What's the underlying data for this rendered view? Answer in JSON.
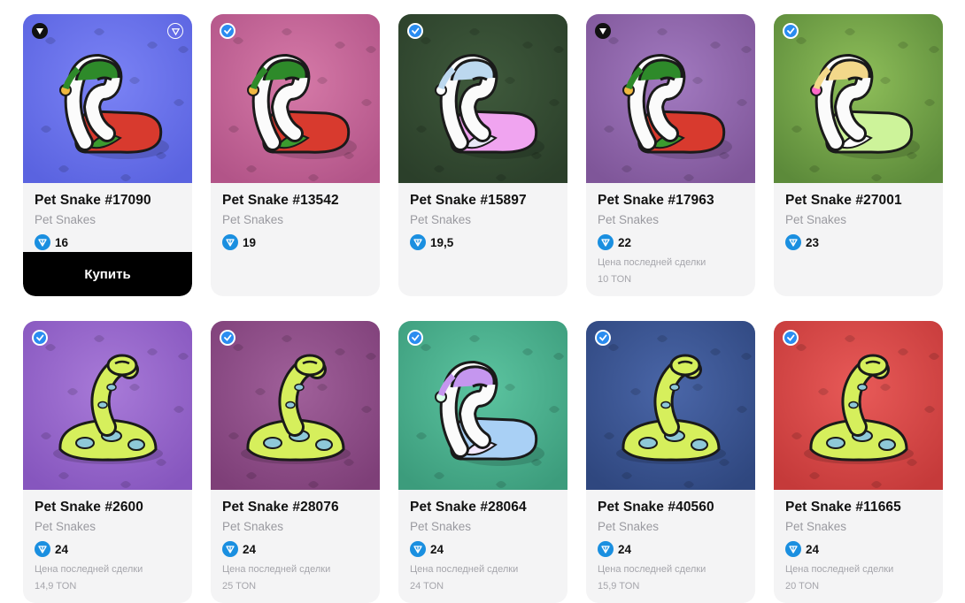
{
  "buy_label": "Купить",
  "ton_icon": "ton-diamond-icon",
  "cards": [
    {
      "title": "Pet Snake #17090",
      "collection": "Pet Snakes",
      "price": "16",
      "last_label": "",
      "last_value": "",
      "badge": "dark",
      "bg1": "#7b83f5",
      "bg2": "#5a63e0",
      "snake": "flamingo-red"
    },
    {
      "title": "Pet Snake #13542",
      "collection": "Pet Snakes",
      "price": "19",
      "last_label": "",
      "last_value": "",
      "badge": "blue",
      "bg1": "#d67aa8",
      "bg2": "#b25488",
      "snake": "flamingo-red"
    },
    {
      "title": "Pet Snake #15897",
      "collection": "Pet Snakes",
      "price": "19,5",
      "last_label": "",
      "last_value": "",
      "badge": "blue",
      "bg1": "#3f5a3c",
      "bg2": "#2b3f2a",
      "snake": "pastel-pink"
    },
    {
      "title": "Pet Snake #17963",
      "collection": "Pet Snakes",
      "price": "22",
      "last_label": "Цена последней сделки",
      "last_value": "10 TON",
      "badge": "dark",
      "bg1": "#a27ac0",
      "bg2": "#7f5699",
      "snake": "flamingo-red"
    },
    {
      "title": "Pet Snake #27001",
      "collection": "Pet Snakes",
      "price": "23",
      "last_label": "",
      "last_value": "",
      "badge": "blue",
      "bg1": "#8fbf5a",
      "bg2": "#5c8a3a",
      "snake": "pastel-green"
    },
    {
      "title": "Pet Snake #2600",
      "collection": "Pet Snakes",
      "price": "24",
      "last_label": "Цена последней сделки",
      "last_value": "14,9 TON",
      "badge": "blue",
      "bg1": "#a87ad8",
      "bg2": "#8656be",
      "snake": "coil-lime"
    },
    {
      "title": "Pet Snake #28076",
      "collection": "Pet Snakes",
      "price": "24",
      "last_label": "Цена последней сделки",
      "last_value": "25 TON",
      "badge": "blue",
      "bg1": "#a0609a",
      "bg2": "#7e3f78",
      "snake": "coil-lime"
    },
    {
      "title": "Pet Snake #28064",
      "collection": "Pet Snakes",
      "price": "24",
      "last_label": "Цена последней сделки",
      "last_value": "24 TON",
      "badge": "blue",
      "bg1": "#5cc4a0",
      "bg2": "#3c9c7c",
      "snake": "pastel-blue"
    },
    {
      "title": "Pet Snake #40560",
      "collection": "Pet Snakes",
      "price": "24",
      "last_label": "Цена последней сделки",
      "last_value": "15,9 TON",
      "badge": "blue",
      "bg1": "#4a66a8",
      "bg2": "#2f477f",
      "snake": "coil-lime"
    },
    {
      "title": "Pet Snake #11665",
      "collection": "Pet Snakes",
      "price": "24",
      "last_label": "Цена последней сделки",
      "last_value": "20 TON",
      "badge": "blue",
      "bg1": "#e85a58",
      "bg2": "#c53a3a",
      "snake": "coil-lime"
    }
  ]
}
